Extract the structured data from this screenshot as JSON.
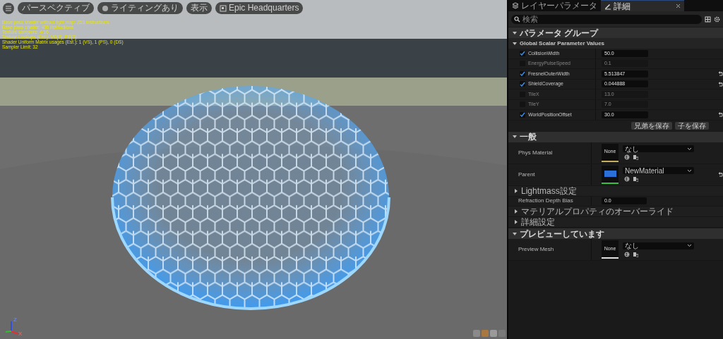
{
  "viewport": {
    "toolbar": [
      {
        "kind": "menu"
      },
      {
        "kind": "text",
        "label": "パースペクティブ"
      },
      {
        "kind": "lit",
        "label": "ライティングあり"
      },
      {
        "kind": "text",
        "label": "表示"
      },
      {
        "kind": "level",
        "label": "Epic Headquarters"
      }
    ],
    "stats": [
      "Base pass shader without light map: 253 instructions",
      "Base pass shader: 436 instructions",
      "Texture samplers: 4/16",
      "Texture Lookups (Est.): VS(3), PS(3)",
      "Shader Uniform Matrix usages (Est.): 1 (VS), 1 (PS), 0 (DS)",
      "Sampler Limit: 32"
    ],
    "gizmo": {
      "labels": [
        "Z",
        "X"
      ]
    }
  },
  "panel": {
    "tabs": [
      {
        "label": "レイヤーパラメータ",
        "selected": false,
        "closable": false
      },
      {
        "label": "詳細",
        "selected": true,
        "closable": true
      }
    ],
    "search": {
      "placeholder": "検索"
    },
    "sections": [
      {
        "title": "パラメータ グループ",
        "expanded": true,
        "groups": [
          {
            "title": "Global Scalar Parameter Values",
            "expanded": true,
            "params": [
              {
                "name": "CollisionWidth",
                "checked": true,
                "value": "50.0",
                "reset": false
              },
              {
                "name": "EnergyPulseSpeed",
                "checked": false,
                "value": "0.1",
                "reset": false
              },
              {
                "name": "FresnelOuterWidth",
                "checked": true,
                "value": "5.513847",
                "reset": true
              },
              {
                "name": "ShieldCoverage",
                "checked": true,
                "value": "0.044888",
                "reset": true
              },
              {
                "name": "TileX",
                "checked": false,
                "value": "13.0",
                "reset": false
              },
              {
                "name": "TileY",
                "checked": false,
                "value": "7.0",
                "reset": false
              },
              {
                "name": "WorldPositionOffset",
                "checked": true,
                "value": "30.0",
                "reset": true
              }
            ],
            "buttons": [
              "兄弟を保存",
              "子を保存"
            ]
          }
        ]
      },
      {
        "title": "一般",
        "expanded": true,
        "rows": [
          {
            "kind": "asset",
            "label": "Phys Material",
            "thumb": "None",
            "value": "なし",
            "color": "#c8b060",
            "reset": false
          },
          {
            "kind": "asset",
            "label": "Parent",
            "value": "NewMaterial",
            "color": "#38c040",
            "reset": true
          },
          {
            "kind": "category",
            "label": "Lightmass設定",
            "expanded": false
          },
          {
            "kind": "number",
            "label": "Refraction Depth Bias",
            "value": "0.0"
          },
          {
            "kind": "category",
            "label": "マテリアルプロパティのオーバーライド",
            "expanded": false
          },
          {
            "kind": "category",
            "label": "詳細設定",
            "expanded": false
          }
        ]
      },
      {
        "title": "プレビューしています",
        "expanded": true,
        "rows": [
          {
            "kind": "asset",
            "label": "Preview Mesh",
            "thumb": "None",
            "value": "なし",
            "color": "#e0e0e0",
            "reset": false
          }
        ]
      }
    ]
  }
}
